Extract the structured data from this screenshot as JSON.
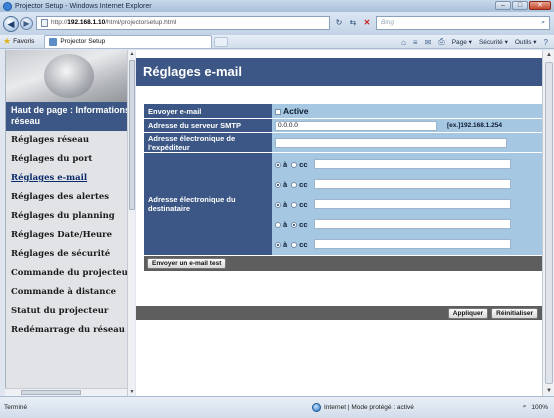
{
  "window": {
    "title": "Projector Setup - Windows Internet Explorer",
    "min_label": "–",
    "max_label": "□",
    "close_label": "✕"
  },
  "address_bar": {
    "back_glyph": "◀",
    "forward_glyph": "▶",
    "url_scheme": "http://",
    "url_host": "192.168.1.10",
    "url_path": "/html/projectorsetup.html",
    "search_placeholder": "Bing",
    "refresh_glyph": "↻",
    "rss_glyph": "⇆",
    "stop_glyph": "✕"
  },
  "favorites_bar": {
    "favorites_label": "Favoris",
    "tab_title": "Projector Setup",
    "commands": [
      "Page ▾",
      "Sécurité ▾",
      "Outils ▾"
    ]
  },
  "left_nav": {
    "header": "Haut de page : Informations réseau",
    "items": [
      "Réglages réseau",
      "Réglages du port",
      "Réglages e-mail",
      "Réglages des alertes",
      "Réglages du planning",
      "Réglages Date/Heure",
      "Réglages de sécurité",
      "Commande du projecteur",
      "Commande à distance",
      "Statut du projecteur",
      "Redémarrage du réseau"
    ],
    "active_index": 2
  },
  "page": {
    "title": "Réglages e-mail",
    "send_email": {
      "label": "Envoyer e-mail",
      "option": "Active",
      "checked": false
    },
    "smtp": {
      "label": "Adresse du serveur SMTP",
      "value": "0.0.0.0",
      "example": "[ex.]192.168.1.254"
    },
    "sender": {
      "label": "Adresse électronique de l'expéditeur",
      "value": ""
    },
    "recipients": {
      "label": "Adresse électronique du destinataire",
      "to_label": "à",
      "cc_label": "cc",
      "rows": [
        {
          "mode": "to",
          "value": ""
        },
        {
          "mode": "to",
          "value": ""
        },
        {
          "mode": "to",
          "value": ""
        },
        {
          "mode": "cc",
          "value": ""
        },
        {
          "mode": "to",
          "value": ""
        }
      ]
    },
    "test_button": "Envoyer un e-mail test",
    "apply_button": "Appliquer",
    "reset_button": "Réinitialiser"
  },
  "status_bar": {
    "left": "Terminé",
    "zone": "Internet | Mode protégé : activé",
    "zoom": "100%"
  },
  "colors": {
    "accent_dark_blue": "#3c5785",
    "form_light_blue": "#a6c7e2",
    "dark_gray_bar": "#5e5e5e"
  }
}
